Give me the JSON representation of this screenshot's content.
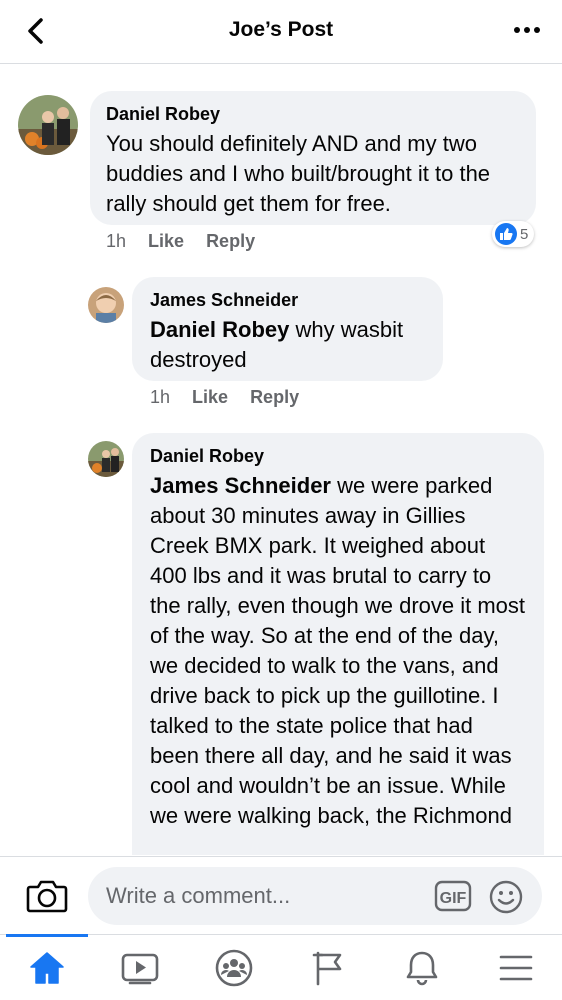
{
  "header": {
    "title": "Joe’s Post",
    "back_icon": "chevron-left-icon",
    "more_icon": "more-horizontal-icon"
  },
  "comments": [
    {
      "author": "Daniel Robey",
      "text_segments": [
        {
          "bold": false,
          "text": "You should definitely AND and my two buddies and I  who built/brought it to the rally should get them for free."
        }
      ],
      "time": "1h",
      "like_label": "Like",
      "reply_label": "Reply",
      "reaction_count": "5"
    },
    {
      "author": "James Schneider",
      "mention": "Daniel Robey",
      "text": " why wasbit destroyed",
      "time": "1h",
      "like_label": "Like",
      "reply_label": "Reply"
    },
    {
      "author": "Daniel Robey",
      "mention": "James Schneider",
      "text": "  we were parked about 30 minutes away in Gillies Creek BMX park. It weighed about 400 lbs and it was brutal to carry to the rally, even though we drove it most of the way. So at the end of the day, we decided to walk to the vans, and drive back to pick up the guillotine. I talked to the state police that had been there all day, and he said it was cool and wouldn’t be an issue. While we were walking back, the Richmond"
    }
  ],
  "composer": {
    "placeholder": "Write a comment...",
    "camera_icon": "camera-icon",
    "gif_label": "GIF",
    "emoji_icon": "emoji-icon"
  },
  "tabs": [
    {
      "icon": "home-icon",
      "active": true
    },
    {
      "icon": "video-icon",
      "active": false
    },
    {
      "icon": "groups-icon",
      "active": false
    },
    {
      "icon": "flag-icon",
      "active": false
    },
    {
      "icon": "bell-icon",
      "active": false
    },
    {
      "icon": "menu-icon",
      "active": false
    }
  ],
  "colors": {
    "accent": "#1877f2",
    "bubble": "#f0f2f5",
    "secondary_text": "#65676b"
  }
}
